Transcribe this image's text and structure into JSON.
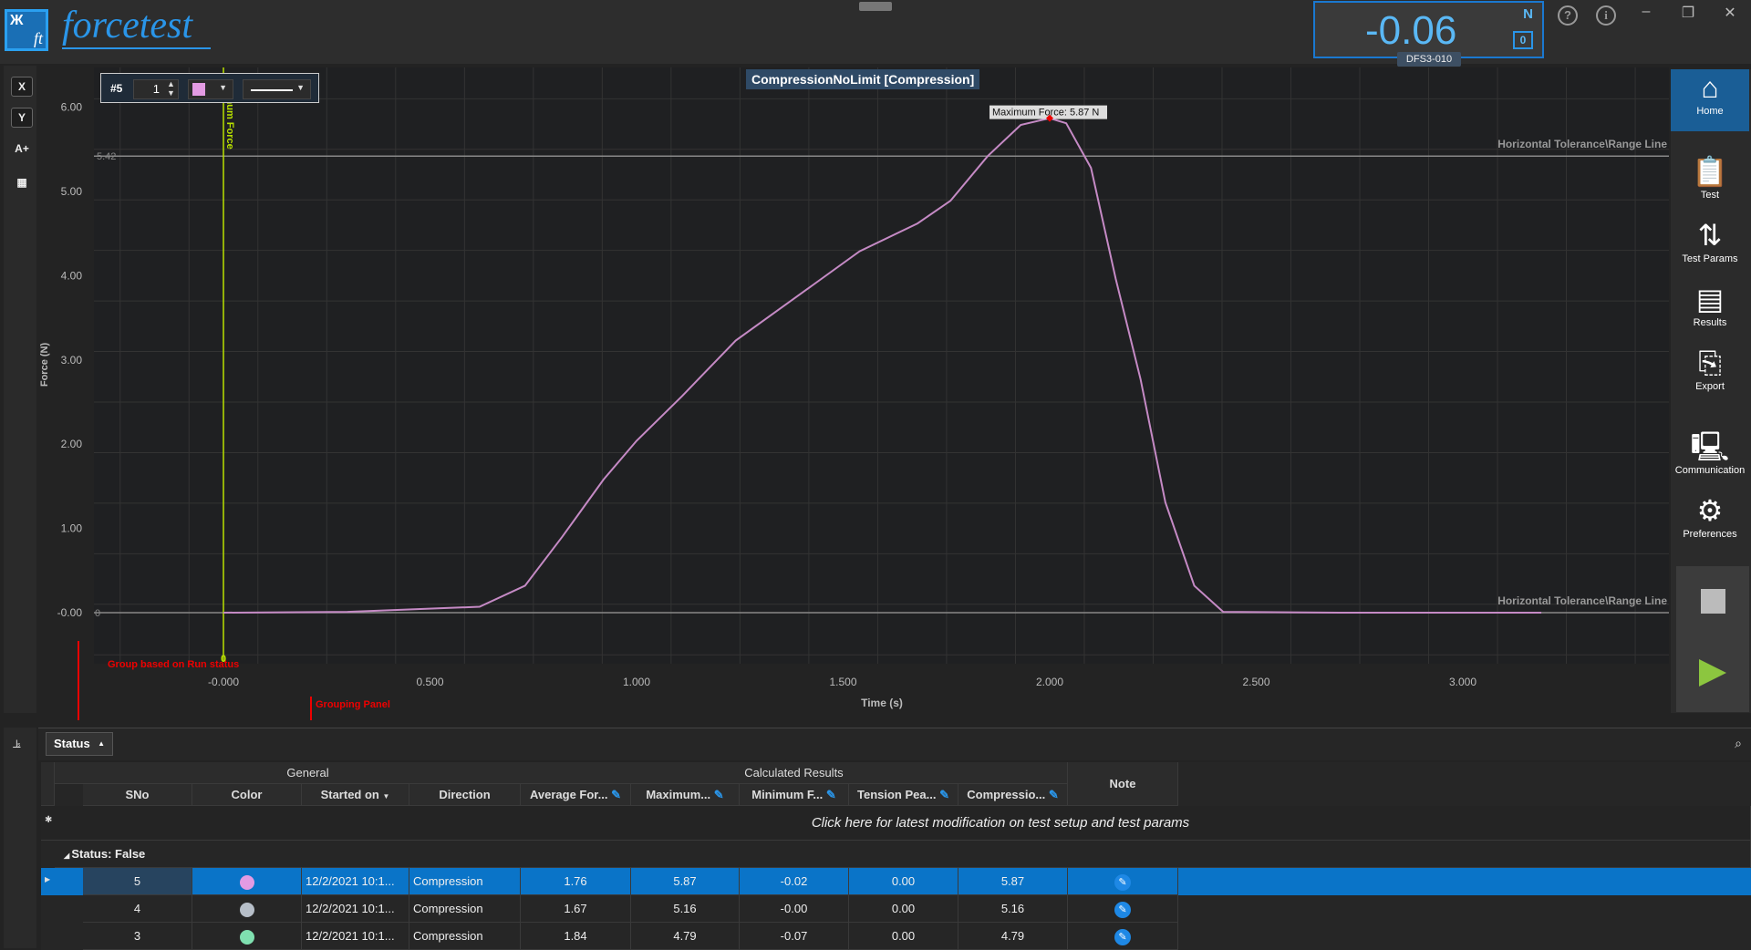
{
  "app": {
    "logo_mark": "ft",
    "logo_text": "forcetest"
  },
  "readout": {
    "value": "-0.06",
    "unit": "N",
    "zero_label": "0",
    "device": "DFS3-010"
  },
  "window": {
    "help_icon": "?",
    "info_icon": "i",
    "minimize": "–",
    "restore": "❐",
    "close": "✕"
  },
  "left_tools": [
    {
      "label": "X",
      "icon": "x-axis-icon"
    },
    {
      "label": "Y",
      "icon": "y-axis-icon"
    },
    {
      "label": "A+",
      "icon": "annotation-icon"
    },
    {
      "label": "▦",
      "icon": "table-icon"
    }
  ],
  "series_bar": {
    "label": "#5",
    "number": "1",
    "color": "#e39be3"
  },
  "chart_data": {
    "type": "line",
    "title": "CompressionNoLimit [Compression]",
    "xlabel": "Time (s)",
    "ylabel": "Force (N)",
    "xlim": [
      -0.25,
      3.45
    ],
    "ylim": [
      -0.55,
      6.3
    ],
    "xticks": [
      "-0.000",
      "0.500",
      "1.000",
      "1.500",
      "2.000",
      "2.500",
      "3.000"
    ],
    "yticks": [
      "6.00",
      "5.00",
      "4.00",
      "3.00",
      "2.00",
      "1.00",
      "-0.00"
    ],
    "grid": true,
    "series": [
      {
        "color": "#c58ac5",
        "x": [
          0,
          0.3,
          0.62,
          0.73,
          0.82,
          0.92,
          1.0,
          1.11,
          1.24,
          1.41,
          1.54,
          1.68,
          1.76,
          1.85,
          1.93,
          2.0,
          2.04,
          2.1,
          2.16,
          2.22,
          2.28,
          2.35,
          2.42,
          2.7,
          3.19
        ],
        "y": [
          0,
          0.01,
          0.07,
          0.32,
          0.9,
          1.58,
          2.04,
          2.57,
          3.23,
          3.83,
          4.29,
          4.62,
          4.89,
          5.42,
          5.79,
          5.87,
          5.81,
          5.28,
          3.96,
          2.77,
          1.31,
          0.32,
          0.01,
          0.0,
          0.0
        ]
      }
    ],
    "annotations": {
      "max_label": "Maximum Force: 5.87 N",
      "max_x": 2.0,
      "max_y": 5.87,
      "tolerance_upper": 5.42,
      "tolerance_upper_label": "5.42",
      "tolerance_lower": 0,
      "tolerance_lower_label": "0",
      "tolerance_line_label": "Horizontal Tolerance\\Range Line",
      "marker_x": 0,
      "marker_label": "Maximum Force",
      "marker_value": "0"
    }
  },
  "callouts": {
    "group_run": "Group based on Run status",
    "grouping_panel": "Grouping Panel"
  },
  "sidebar": [
    {
      "label": "Home",
      "icon": "home-icon"
    },
    {
      "label": "Test",
      "icon": "test-icon"
    },
    {
      "label": "Test Params",
      "icon": "test-params-icon"
    },
    {
      "label": "Results",
      "icon": "results-icon"
    },
    {
      "label": "Export",
      "icon": "export-icon"
    },
    {
      "label": "Communication",
      "icon": "communication-icon"
    },
    {
      "label": "Preferences",
      "icon": "preferences-icon"
    }
  ],
  "grouping": {
    "chip": "Status"
  },
  "table": {
    "groups": [
      "General",
      "Calculated Results"
    ],
    "columns": [
      "SNo",
      "Color",
      "Started on",
      "Direction",
      "Average For...",
      "Maximum...",
      "Minimum F...",
      "Tension Pea...",
      "Compressio...",
      "Note"
    ],
    "new_row_text": "Click here for latest modification on test setup and test params",
    "group_row": "Status: False",
    "rows": [
      {
        "sno": "5",
        "color": "#e39be3",
        "started": "12/2/2021 10:1...",
        "direction": "Compression",
        "avg": "1.76",
        "max": "5.87",
        "min": "-0.02",
        "tension": "0.00",
        "compression": "5.87",
        "selected": true
      },
      {
        "sno": "4",
        "color": "#b6bec8",
        "started": "12/2/2021 10:1...",
        "direction": "Compression",
        "avg": "1.67",
        "max": "5.16",
        "min": "-0.00",
        "tension": "0.00",
        "compression": "5.16"
      },
      {
        "sno": "3",
        "color": "#7fe0b0",
        "started": "12/2/2021 10:1...",
        "direction": "Compression",
        "avg": "1.84",
        "max": "4.79",
        "min": "-0.07",
        "tension": "0.00",
        "compression": "4.79"
      }
    ]
  }
}
